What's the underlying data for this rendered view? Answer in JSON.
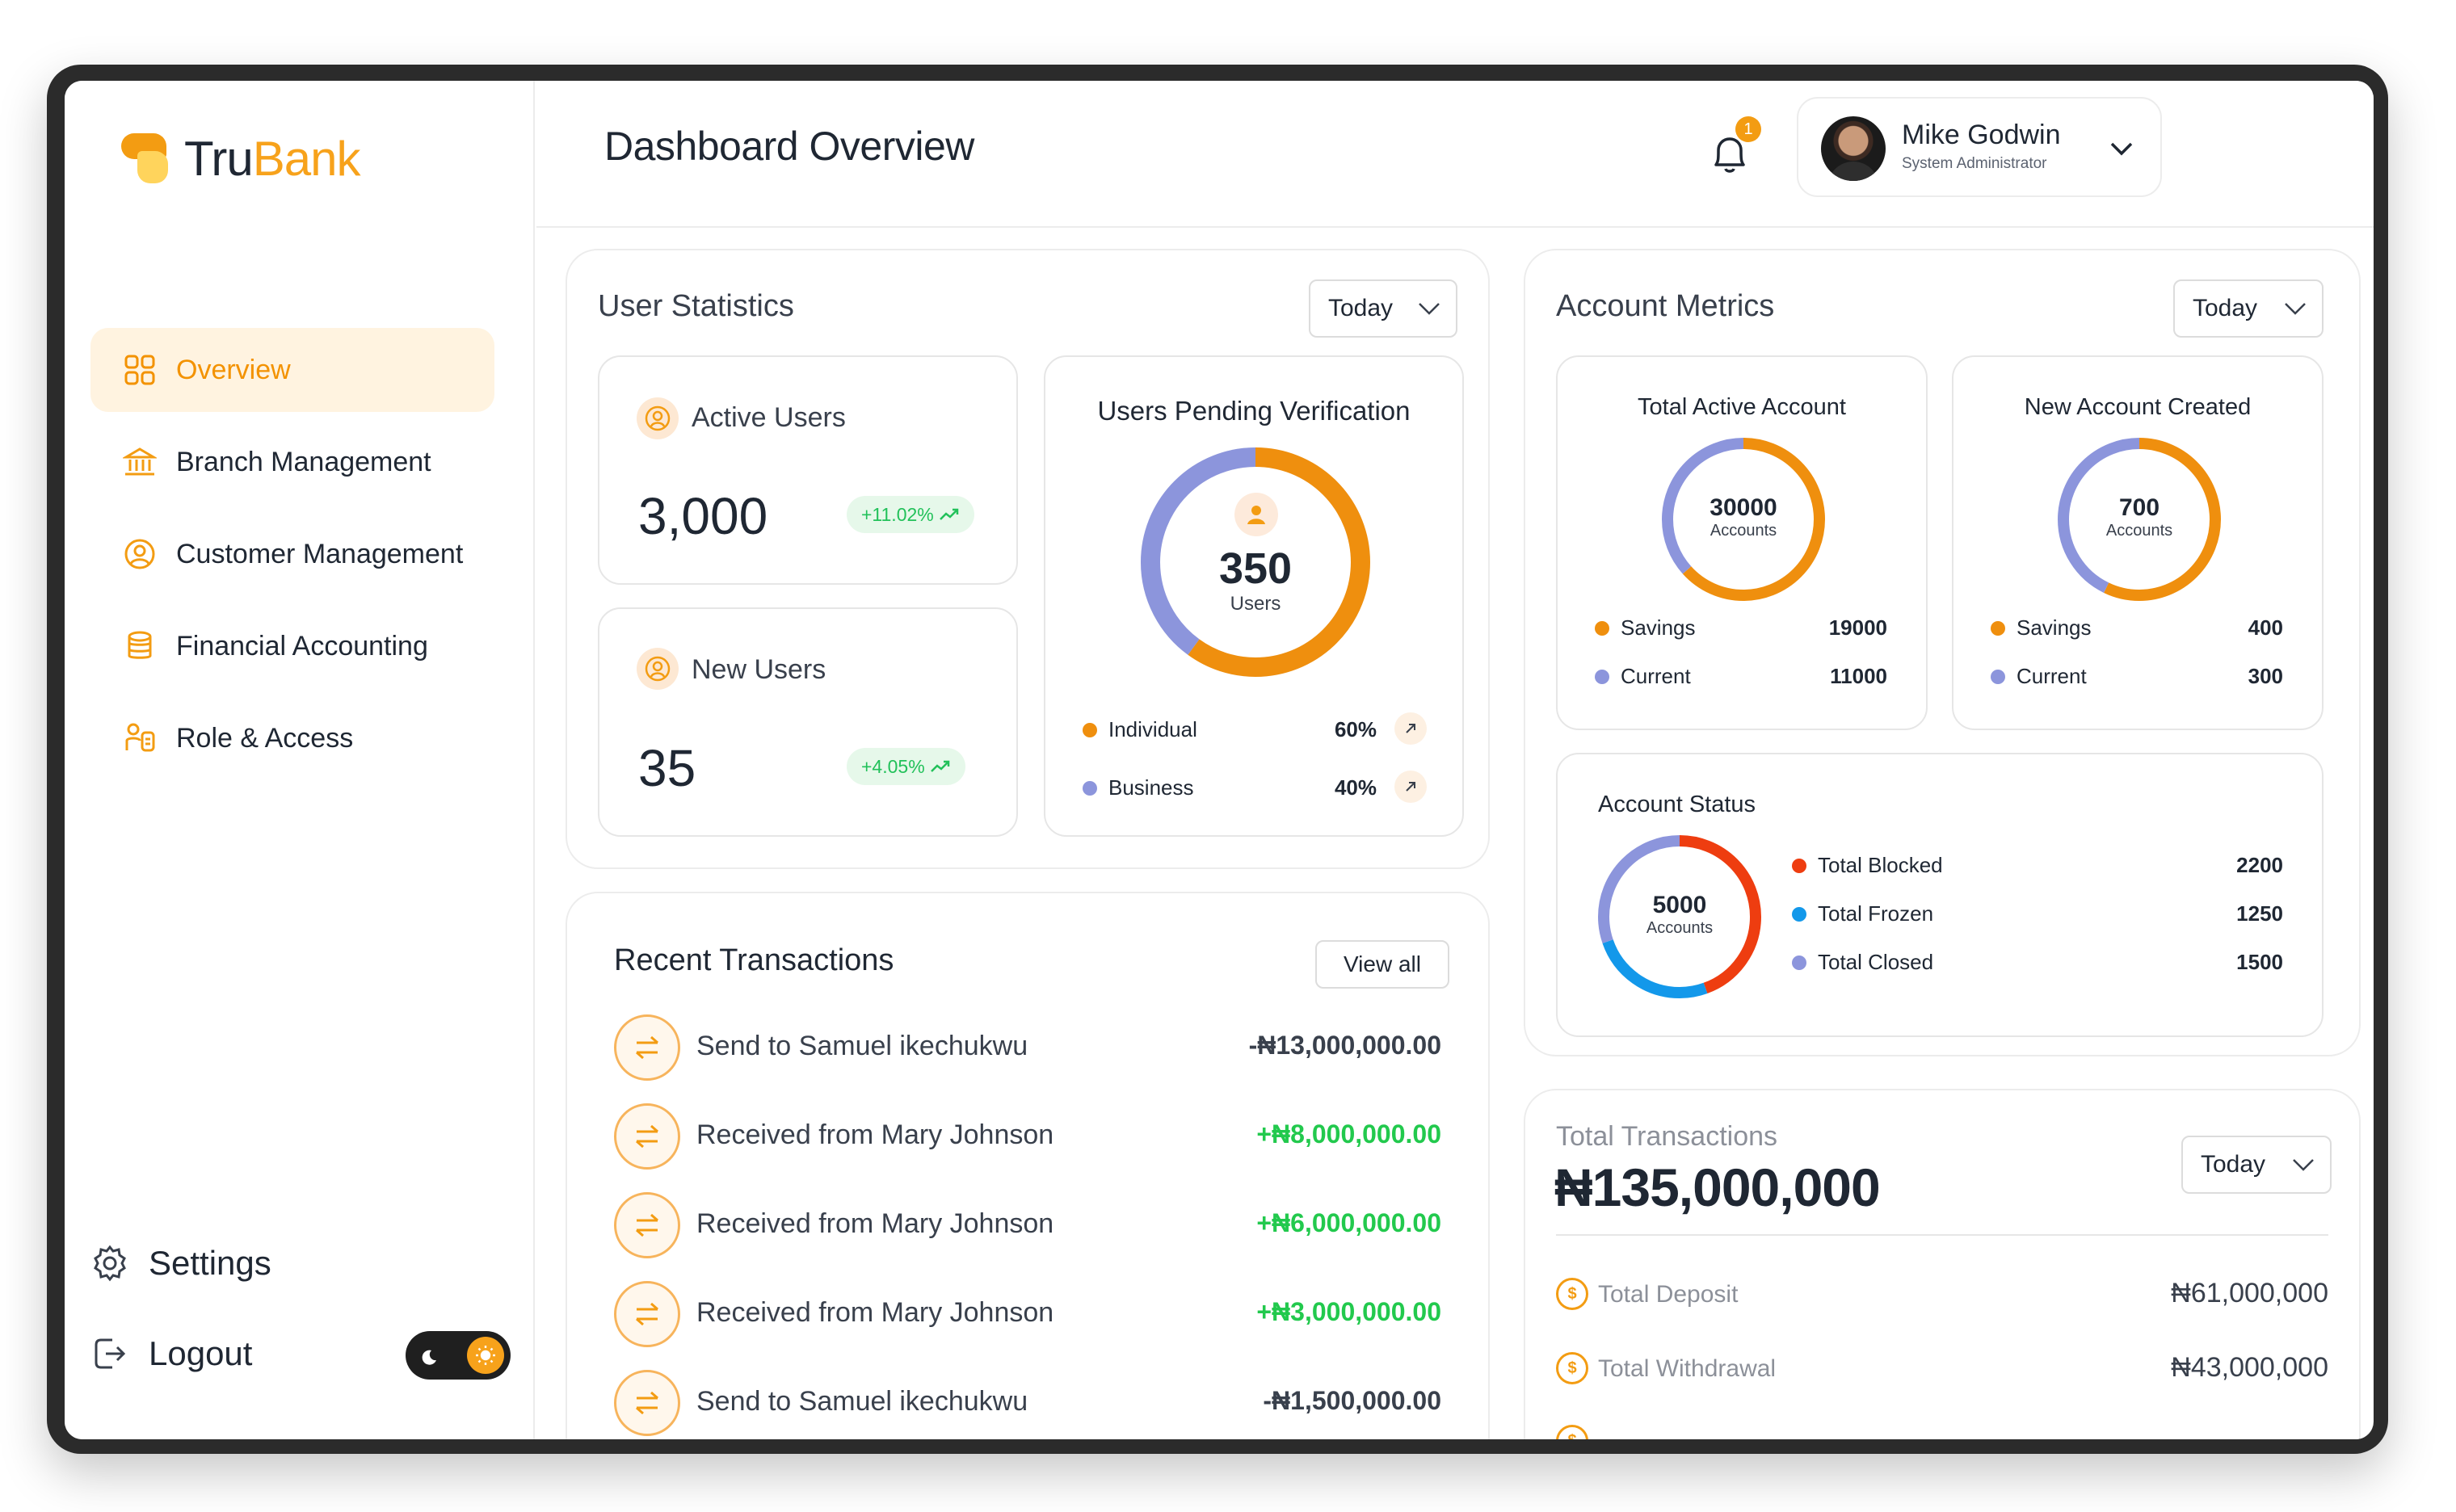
{
  "brand": {
    "name_part1": "Tru",
    "name_part2": "Bank"
  },
  "sidebar": {
    "items": [
      {
        "label": "Overview",
        "icon": "grid-icon",
        "active": true
      },
      {
        "label": "Branch Management",
        "icon": "bank-icon",
        "active": false
      },
      {
        "label": "Customer Management",
        "icon": "user-circle-icon",
        "active": false
      },
      {
        "label": "Financial Accounting",
        "icon": "database-icon",
        "active": false
      },
      {
        "label": "Role & Access",
        "icon": "role-icon",
        "active": false
      }
    ],
    "settings_label": "Settings",
    "logout_label": "Logout"
  },
  "header": {
    "title": "Dashboard Overview",
    "notification_count": "1",
    "user": {
      "name": "Mike Godwin",
      "role": "System Administrator"
    }
  },
  "user_statistics": {
    "title": "User Statistics",
    "period": "Today",
    "active_users": {
      "label": "Active Users",
      "value": "3,000",
      "change": "+11.02%"
    },
    "new_users": {
      "label": "New Users",
      "value": "35",
      "change": "+4.05%"
    },
    "pending": {
      "title": "Users Pending Verification",
      "value": "350",
      "unit": "Users",
      "segments": [
        {
          "label": "Individual",
          "percent": "60%",
          "fraction": 0.6,
          "color": "#ef8f0e"
        },
        {
          "label": "Business",
          "percent": "40%",
          "fraction": 0.4,
          "color": "#8c95dc"
        }
      ]
    }
  },
  "account_metrics": {
    "title": "Account Metrics",
    "period": "Today",
    "total_active": {
      "title": "Total Active Account",
      "value": "30000",
      "unit": "Accounts",
      "rows": [
        {
          "label": "Savings",
          "value": "19000",
          "color": "#ef8f0e"
        },
        {
          "label": "Current",
          "value": "11000",
          "color": "#8c95dc"
        }
      ]
    },
    "new_created": {
      "title": "New Account Created",
      "value": "700",
      "unit": "Accounts",
      "rows": [
        {
          "label": "Savings",
          "value": "400",
          "color": "#ef8f0e"
        },
        {
          "label": "Current",
          "value": "300",
          "color": "#8c95dc"
        }
      ]
    },
    "status": {
      "title": "Account Status",
      "value": "5000",
      "unit": "Accounts",
      "rows": [
        {
          "label": "Total Blocked",
          "value": "2200",
          "color": "#ee3d10"
        },
        {
          "label": "Total Frozen",
          "value": "1250",
          "color": "#1398ea"
        },
        {
          "label": "Total Closed",
          "value": "1500",
          "color": "#8c95dc"
        }
      ]
    }
  },
  "recent_transactions": {
    "title": "Recent Transactions",
    "view_all_label": "View all",
    "items": [
      {
        "label": "Send to Samuel ikechukwu",
        "amount": "-₦13,000,000.00",
        "type": "debit"
      },
      {
        "label": "Received from Mary Johnson",
        "amount": "+₦8,000,000.00",
        "type": "credit"
      },
      {
        "label": "Received from Mary Johnson",
        "amount": "+₦6,000,000.00",
        "type": "credit"
      },
      {
        "label": "Received from Mary Johnson",
        "amount": "+₦3,000,000.00",
        "type": "credit"
      },
      {
        "label": "Send to Samuel ikechukwu",
        "amount": "-₦1,500,000.00",
        "type": "debit"
      }
    ]
  },
  "total_transactions": {
    "label": "Total Transactions",
    "value": "₦135,000,000",
    "period": "Today",
    "rows": [
      {
        "label": "Total Deposit",
        "value": "₦61,000,000"
      },
      {
        "label": "Total Withdrawal",
        "value": "₦43,000,000"
      }
    ]
  },
  "colors": {
    "accent": "#f39c12",
    "positive": "#22c94d",
    "primary_text": "#1f2733"
  }
}
